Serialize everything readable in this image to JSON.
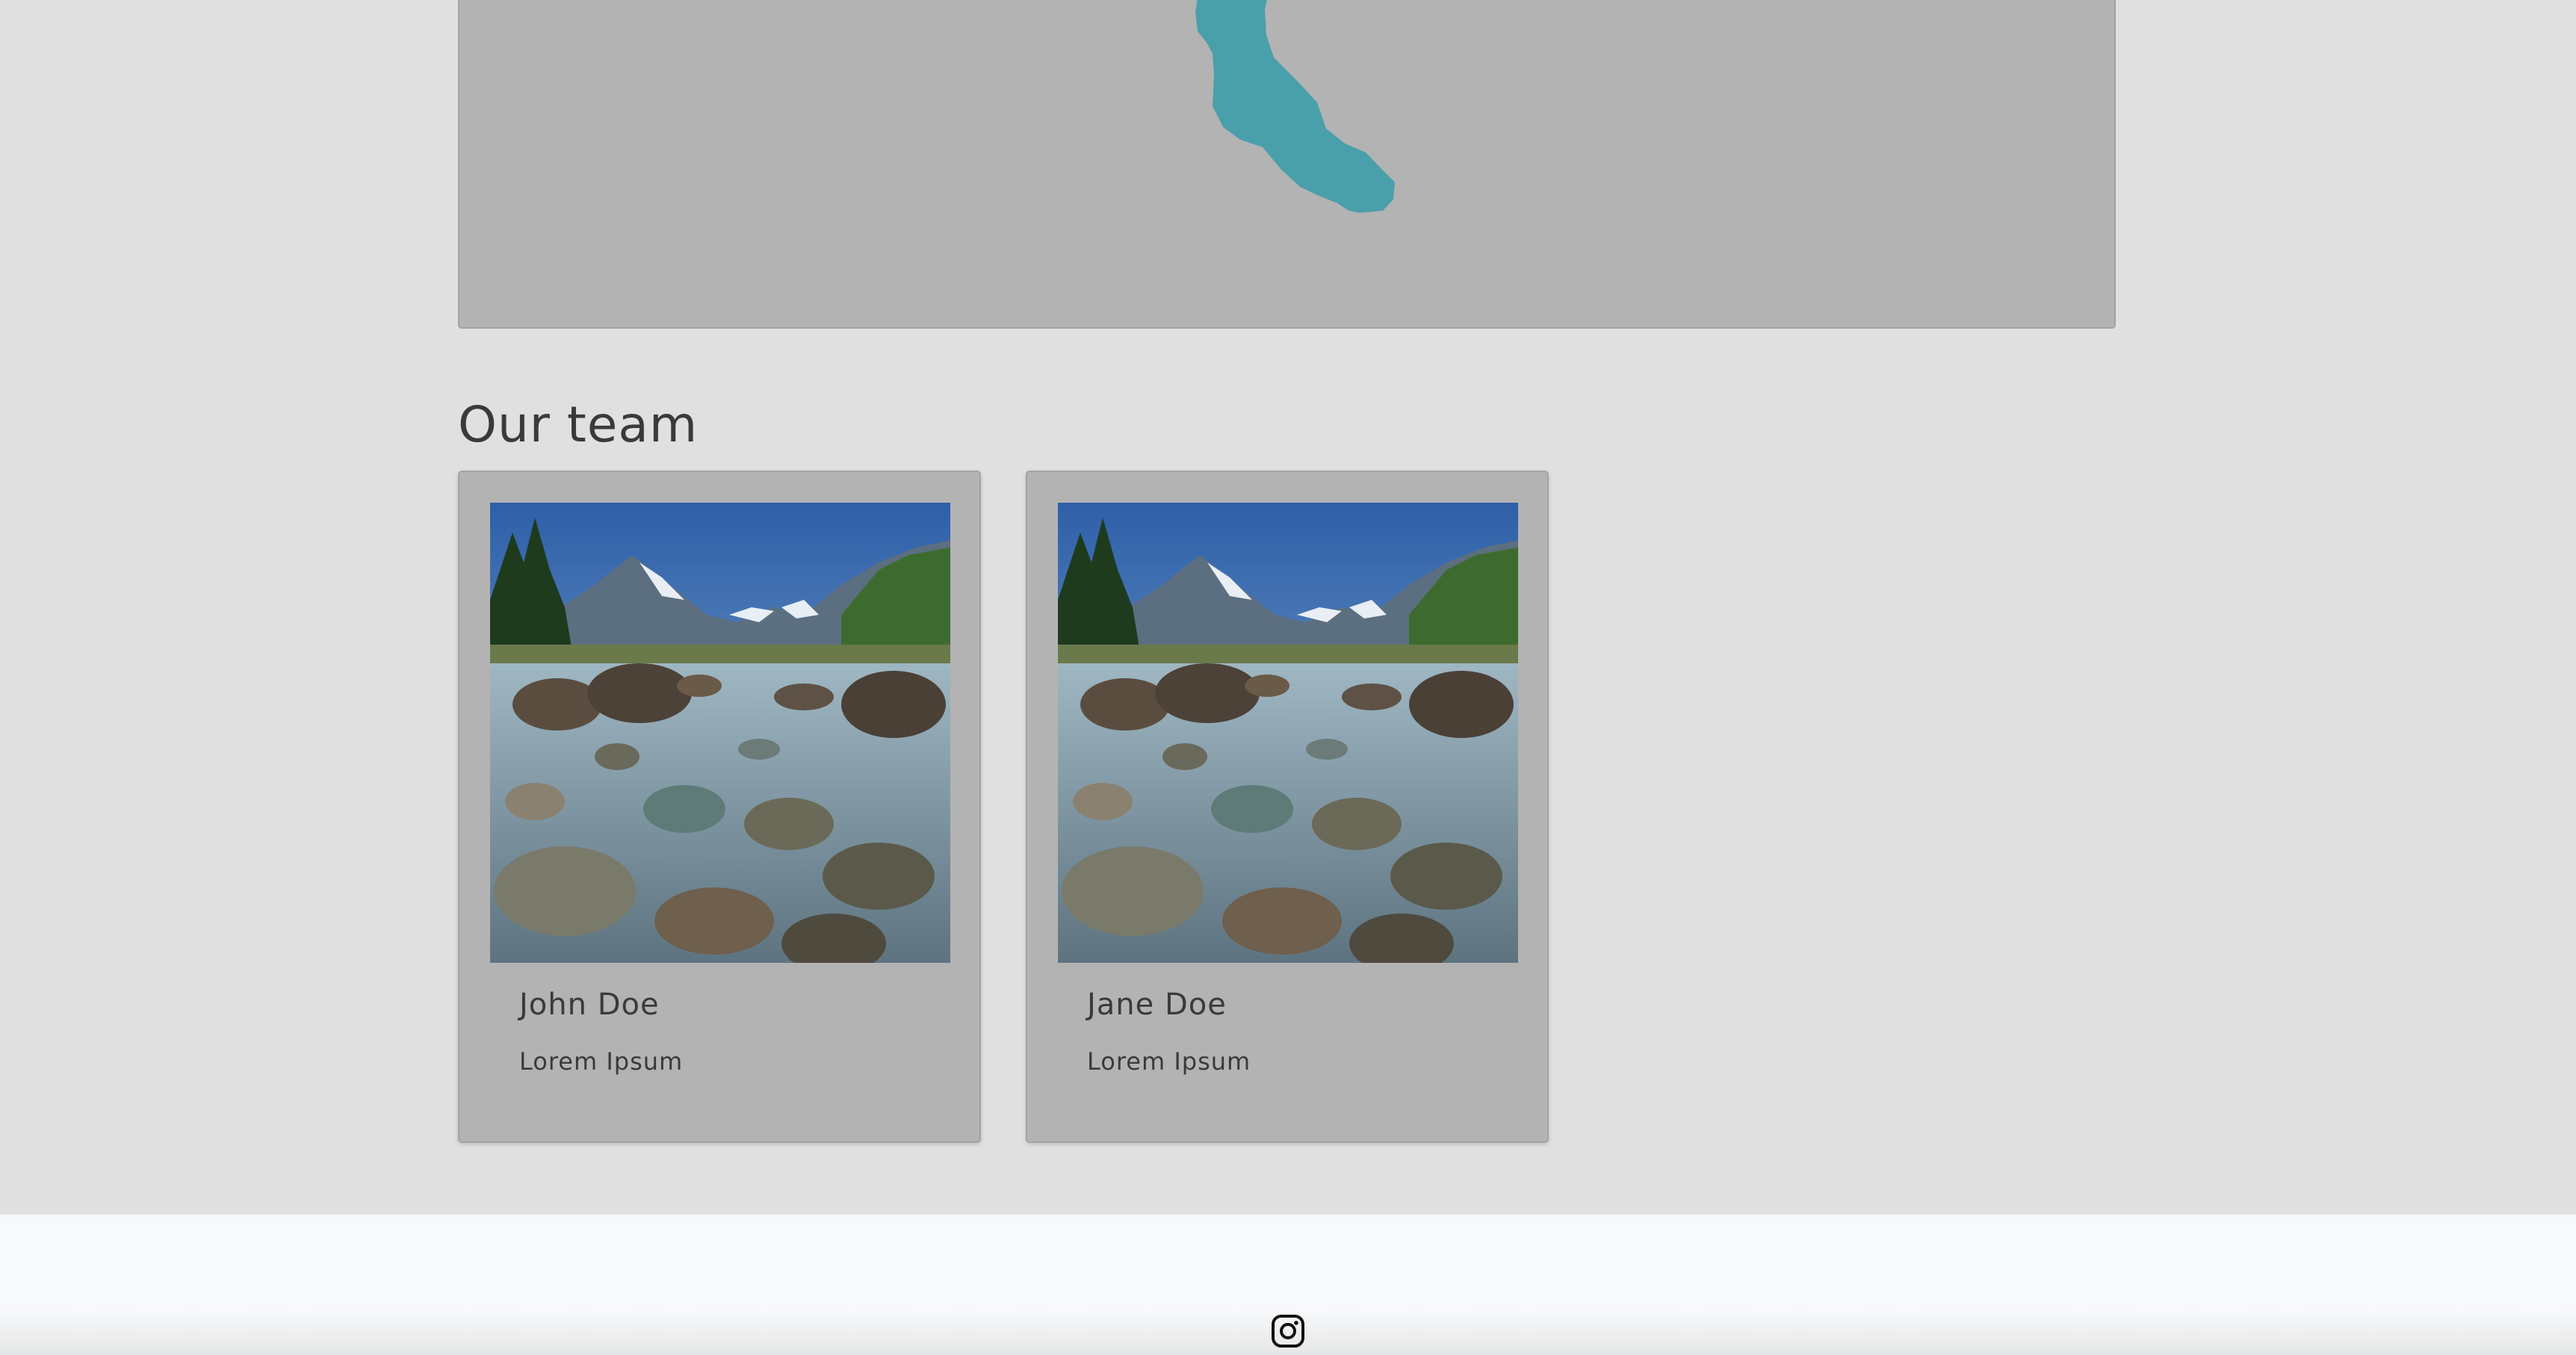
{
  "map": {
    "fill_color": "#b3b3b3",
    "region_color": "#4aa0aa"
  },
  "team_section": {
    "title": "Our team",
    "members": [
      {
        "name": "John Doe",
        "role": "Lorem Ipsum",
        "photo": "mountain-river-landscape"
      },
      {
        "name": "Jane Doe",
        "role": "Lorem Ipsum",
        "photo": "mountain-river-landscape"
      }
    ]
  },
  "footer": {
    "social_icons": [
      "instagram-icon"
    ]
  }
}
